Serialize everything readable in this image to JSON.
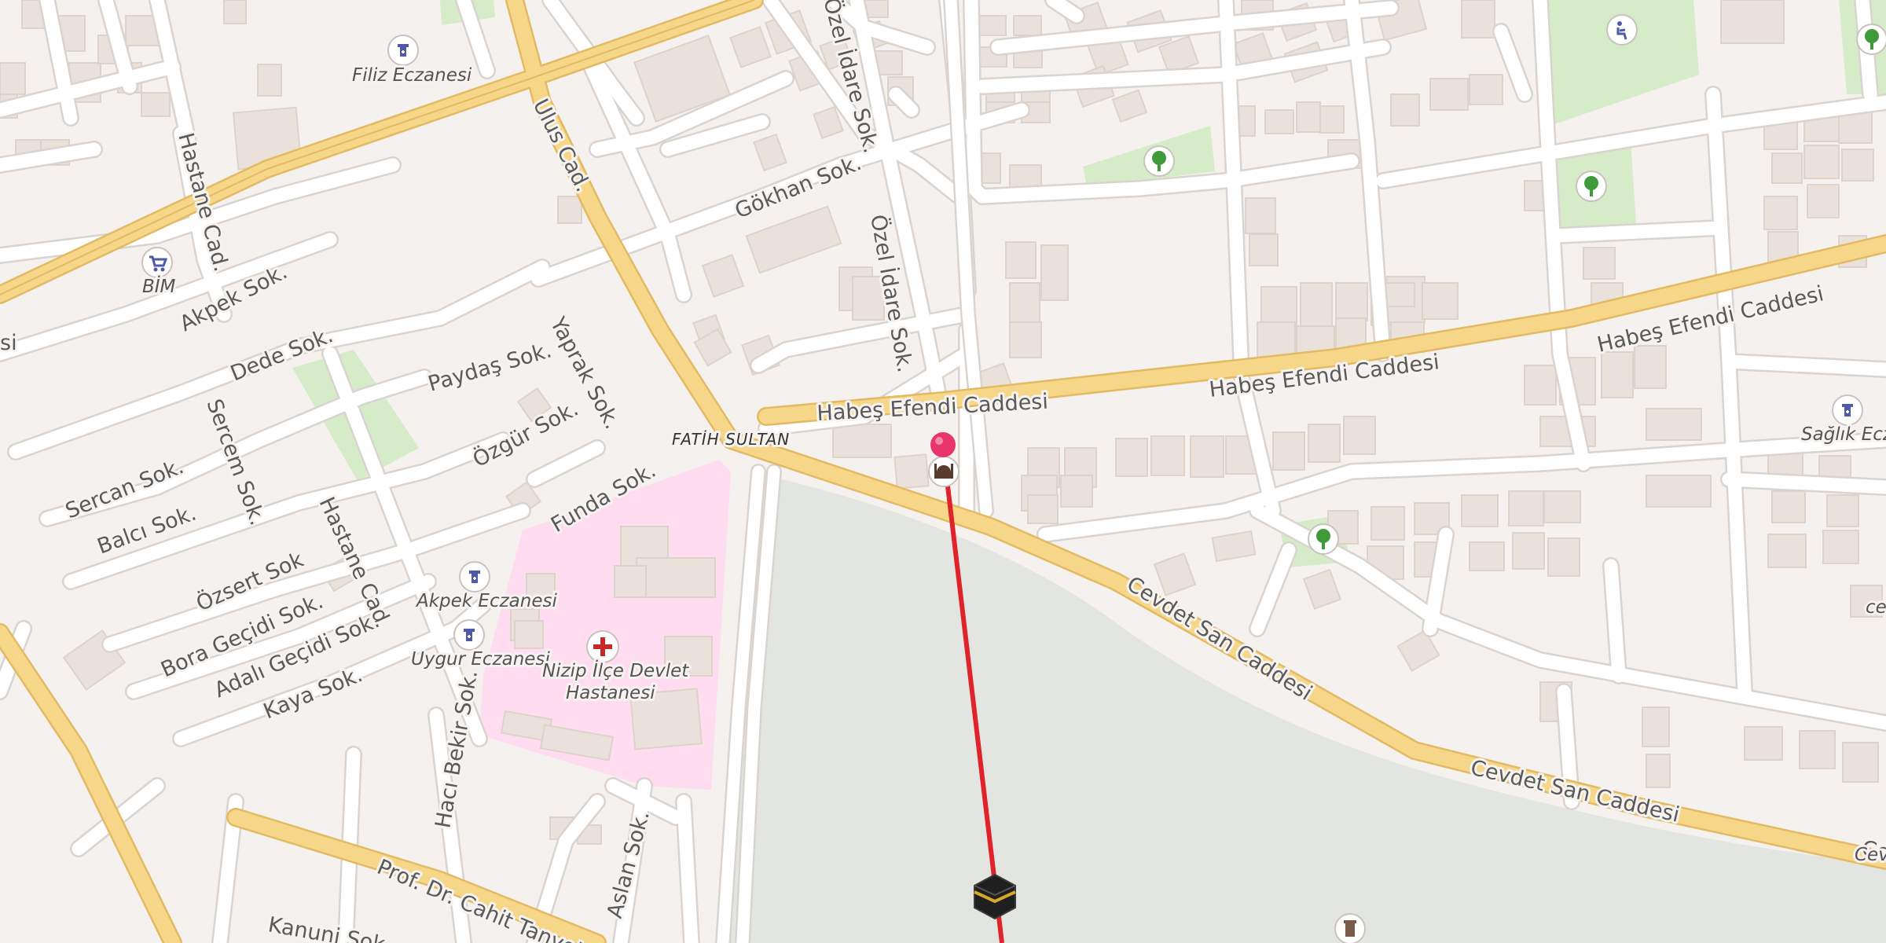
{
  "colors": {
    "background": "#f4f1ee",
    "building": "#e9e1da",
    "building_edge": "#ddd3ca",
    "minor_road": "#ffffff",
    "minor_road_casing": "#d9d4cf",
    "main_road": "#f6d78a",
    "main_road_casing": "#e3ba63",
    "park": "#d6ecc8",
    "hospital_area": "#ffdcef",
    "water": "#e3e5e0",
    "qibla_line": "#e0222b",
    "pin": "#e8356a",
    "poi_icon": "#4e5aa8",
    "tree_icon": "#3f9a3a",
    "hospital_cross": "#c62828"
  },
  "streets": [
    {
      "id": "ulus",
      "label": "Ulus Cad."
    },
    {
      "id": "gokhan",
      "label": "Gökhan Sok."
    },
    {
      "id": "ozel1",
      "label": "Özel İdare Sok."
    },
    {
      "id": "ozel2",
      "label": "Özel İdare Sok."
    },
    {
      "id": "hastane1",
      "label": "Hastane Cad."
    },
    {
      "id": "akpek",
      "label": "Akpek Sok."
    },
    {
      "id": "dede",
      "label": "Dede Sok."
    },
    {
      "id": "paydas",
      "label": "Paydaş Sok."
    },
    {
      "id": "yaprak",
      "label": "Yaprak Sok."
    },
    {
      "id": "ozgur",
      "label": "Özgür Sok."
    },
    {
      "id": "sercem",
      "label": "Sercem Sok."
    },
    {
      "id": "sercan",
      "label": "Sercan Sok."
    },
    {
      "id": "balci",
      "label": "Balcı Sok."
    },
    {
      "id": "funda",
      "label": "Funda Sok."
    },
    {
      "id": "habes1",
      "label": "Habeş Efendi Caddesi"
    },
    {
      "id": "habes2",
      "label": "Habeş Efendi Caddesi"
    },
    {
      "id": "habes3",
      "label": "Habeş Efendi Caddesi"
    },
    {
      "id": "hastane2",
      "label": "Hastane Cad."
    },
    {
      "id": "ozsert",
      "label": "Özsert Sok"
    },
    {
      "id": "bora",
      "label": "Bora Geçidi Sok."
    },
    {
      "id": "adali",
      "label": "Adalı Geçidi Sok."
    },
    {
      "id": "kaya",
      "label": "Kaya Sok."
    },
    {
      "id": "haci",
      "label": "Hacı Bekir Sok."
    },
    {
      "id": "cevdet1",
      "label": "Cevdet San Caddesi"
    },
    {
      "id": "cevdet2",
      "label": "Cevdet San Caddesi"
    },
    {
      "id": "cevdet3",
      "label": "Cevdet San Caddesi"
    },
    {
      "id": "prof",
      "label": "Prof. Dr. Cahit Tanyol Cad"
    },
    {
      "id": "aslan",
      "label": "Aslan Sok."
    },
    {
      "id": "kanuni",
      "label": "Kanuni Sok."
    },
    {
      "id": "edge",
      "label": "si"
    }
  ],
  "district": {
    "label": "FATİH SULTAN"
  },
  "pois": [
    {
      "id": "filiz",
      "type": "pharmacy-icon",
      "label": "Filiz Eczanesi"
    },
    {
      "id": "bim",
      "type": "shopping-cart-icon",
      "label": "BİM"
    },
    {
      "id": "akpek_ecz",
      "type": "pharmacy-icon",
      "label": "Akpek Eczanesi"
    },
    {
      "id": "uygur",
      "type": "pharmacy-icon",
      "label": "Uygur Eczanesi"
    },
    {
      "id": "hospital",
      "type": "hospital-cross-icon",
      "label": "Nizip İlçe Devlet",
      "label2": "Hastanesi"
    },
    {
      "id": "saglik",
      "type": "pharmacy-icon",
      "label": "Sağlık Eczan"
    },
    {
      "id": "edge_ce",
      "type": "text",
      "label": "ce"
    },
    {
      "id": "edge_cev",
      "type": "text",
      "label": "Cev"
    }
  ],
  "markers": {
    "pin": "location-pin",
    "mosque": "mosque-icon",
    "kaaba": "kaaba-icon",
    "park_icons": [
      "tree-icon",
      "tree-icon",
      "tree-icon",
      "tree-icon"
    ],
    "playground": "playground-icon",
    "monument": "monument-icon"
  }
}
